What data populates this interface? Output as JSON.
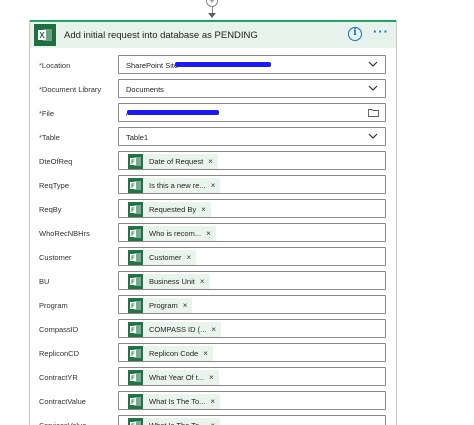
{
  "connector": {
    "symbol": "+"
  },
  "card": {
    "title": "Add initial request into database as PENDING",
    "info_symbol": "i",
    "more_symbol": "···"
  },
  "fields": [
    {
      "label": "Location",
      "required": true,
      "value": "SharePoint Site -",
      "control": "dropdown"
    },
    {
      "label": "Document Library",
      "required": true,
      "value": "Documents",
      "control": "dropdown"
    },
    {
      "label": "File",
      "required": true,
      "value": "/",
      "control": "file-picker"
    },
    {
      "label": "Table",
      "required": true,
      "value": "Table1",
      "control": "dropdown"
    },
    {
      "label": "DteOfReq",
      "required": false,
      "token": "Date of Request"
    },
    {
      "label": "ReqType",
      "required": false,
      "token": "Is this a new re..."
    },
    {
      "label": "ReqBy",
      "required": false,
      "token": "Requested By"
    },
    {
      "label": "WhoRecNBHrs",
      "required": false,
      "token": "Who is recom..."
    },
    {
      "label": "Customer",
      "required": false,
      "token": "Customer"
    },
    {
      "label": "BU",
      "required": false,
      "token": "Business Unit"
    },
    {
      "label": "Program",
      "required": false,
      "token": "Program"
    },
    {
      "label": "CompassID",
      "required": false,
      "token": "COMPASS ID (..."
    },
    {
      "label": "RepliconCD",
      "required": false,
      "token": "Replicon Code"
    },
    {
      "label": "ContractYR",
      "required": false,
      "token": "What Year Of t..."
    },
    {
      "label": "ContractValue",
      "required": false,
      "token": "What Is The To..."
    },
    {
      "label": "ServicesValue",
      "required": false,
      "token": "What Is The To..."
    }
  ],
  "required_marker": "*",
  "token_remove_symbol": "×",
  "icons": {
    "excel": "excel-icon",
    "forms": "forms-icon",
    "chevron": "chevron-down-icon",
    "folder": "folder-icon"
  },
  "colors": {
    "header_bg": "#e7f2ec",
    "excel_green": "#1d6f42",
    "token_bg": "#e9f4ee",
    "accent_blue": "#106ebe",
    "redaction": "#1b1bf2"
  }
}
